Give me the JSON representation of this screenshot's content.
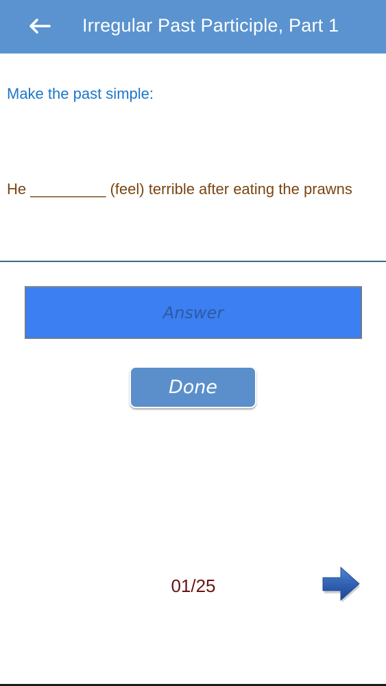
{
  "header": {
    "title": "Irregular Past Participle, Part 1",
    "back_icon": "left-arrow-icon",
    "background_color": "#5a93cf"
  },
  "exercise": {
    "instruction": "Make the past simple:",
    "question": "He _________ (feel) terrible after eating the prawns"
  },
  "answer": {
    "placeholder": "Answer",
    "value": ""
  },
  "done_button": {
    "label": "Done"
  },
  "navigation": {
    "counter": "01/25",
    "next_icon": "right-arrow-icon"
  },
  "colors": {
    "instruction_text": "#1d76c8",
    "question_text": "#7a4512",
    "answer_field_background": "#3b7ff2",
    "done_button_background": "#5b8fcb",
    "counter_text": "#6b1111",
    "next_arrow": "#2f5fb0"
  }
}
